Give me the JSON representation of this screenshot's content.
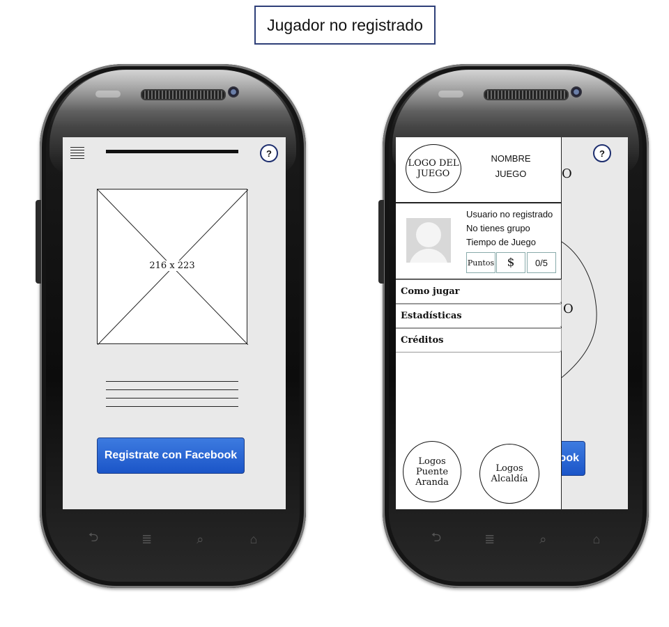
{
  "header": {
    "title": "Jugador no registrado"
  },
  "phone1": {
    "help": "?",
    "image_placeholder": "216 x 223",
    "facebook_button": "Registrate con Facebook"
  },
  "phone2": {
    "help": "?",
    "background_fragment_1": "O",
    "background_fragment_2": "O",
    "facebook_fragment": "ook",
    "logo_game": "LOGO DEL JUEGO",
    "game_name_line1": "NOMBRE",
    "game_name_line2": "JUEGO",
    "user": {
      "status": "Usuario no registrado",
      "group": "No tienes grupo",
      "time": "Tiempo de Juego",
      "points_label": "Puntos",
      "money_label": "$",
      "progress": "0/5"
    },
    "menu": [
      "Como jugar",
      "Estadísticas",
      "Créditos"
    ],
    "logo_puente": "Logos Puente Aranda",
    "logo_alcaldia": "Logos Alcaldía"
  },
  "nav_icons": [
    "back-icon",
    "menu-icon",
    "search-icon",
    "home-icon"
  ]
}
